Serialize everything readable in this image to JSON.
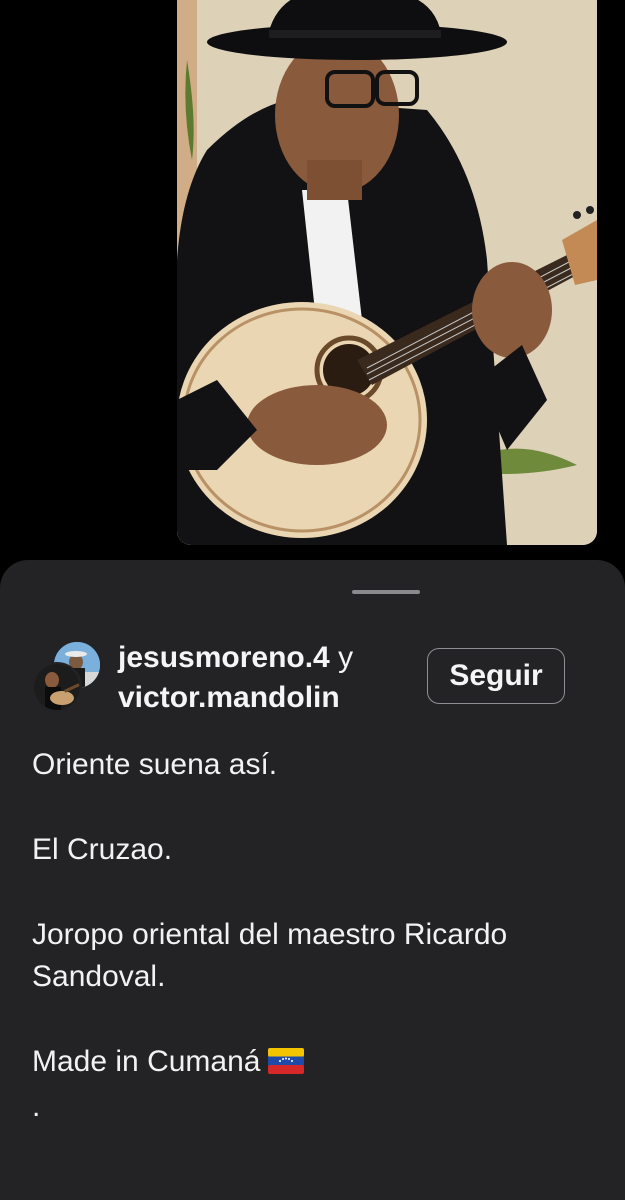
{
  "post": {
    "usernames": {
      "first": "jesusmoreno.4",
      "conjunction": "y",
      "second": "victor.mandolin"
    },
    "follow_label": "Seguir",
    "caption": [
      "Oriente suena así.",
      "El Cruzao.",
      "Joropo oriental del maestro Ricardo Sandoval.",
      "Made in Cumaná",
      "."
    ],
    "flag_emoji": "venezuela-flag-icon"
  },
  "colors": {
    "sheet_bg": "#232326",
    "page_bg": "#000000",
    "text": "#f2f2f2",
    "button_border": "#8e8e93"
  }
}
